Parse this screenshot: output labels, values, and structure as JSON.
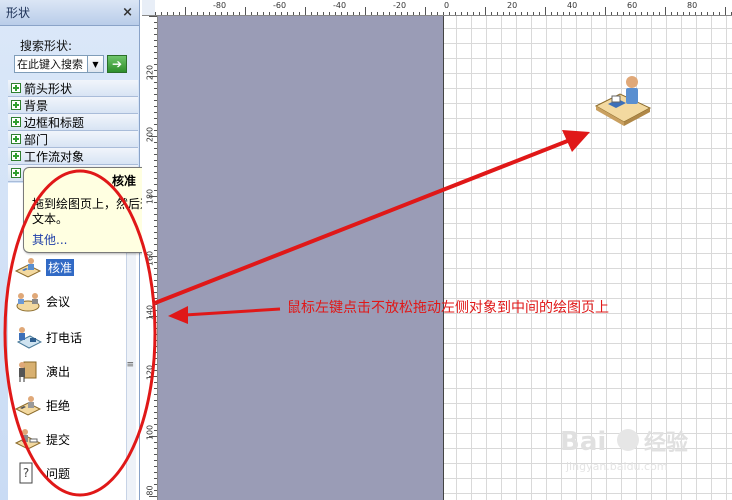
{
  "shapes_pane": {
    "title": "形状",
    "close_glyph": "×",
    "search_label": "搜索形状:",
    "search_value": "在此键入搜索",
    "dropdown_icon": "chevron-down-icon",
    "go_icon": "arrow-right-icon",
    "go_glyph": "➔",
    "categories": [
      {
        "label": "箭头形状"
      },
      {
        "label": "背景"
      },
      {
        "label": "边框和标题"
      },
      {
        "label": "部门"
      },
      {
        "label": "工作流对象"
      }
    ],
    "scroll_grip": "≡"
  },
  "stencil": {
    "shapes": [
      {
        "label": "核准",
        "icon": "approve-icon"
      },
      {
        "label": "会议",
        "icon": "meeting-icon"
      },
      {
        "label": "打电话",
        "icon": "phone-call-icon"
      },
      {
        "label": "演出",
        "icon": "presentation-icon"
      },
      {
        "label": "拒绝",
        "icon": "reject-icon"
      },
      {
        "label": "提交",
        "icon": "submit-icon"
      },
      {
        "label": "问题",
        "icon": "question-icon"
      }
    ]
  },
  "tooltip": {
    "title": "核准",
    "text": "拖到绘图页上，然后通过键入添加文本。",
    "more_link": "其他..."
  },
  "rulers": {
    "top_labels": [
      "-80",
      "-60",
      "-40",
      "-20",
      "0",
      "20",
      "40",
      "60",
      "80"
    ],
    "left_labels": [
      "220",
      "200",
      "180",
      "160",
      "140",
      "120",
      "100",
      "80"
    ]
  },
  "annotation": {
    "text": "鼠标左键点击不放松拖动左侧对象到中间的绘图页上",
    "color": "#e01818"
  },
  "colors": {
    "pasteboard": "#9a9cb6",
    "pane_background": "#c9dbf4",
    "accent_highlight": "#316ac5"
  },
  "watermark": {
    "brand": "Bai",
    "brand_suffix": "经验",
    "url": "jingyan.baidu.com"
  }
}
